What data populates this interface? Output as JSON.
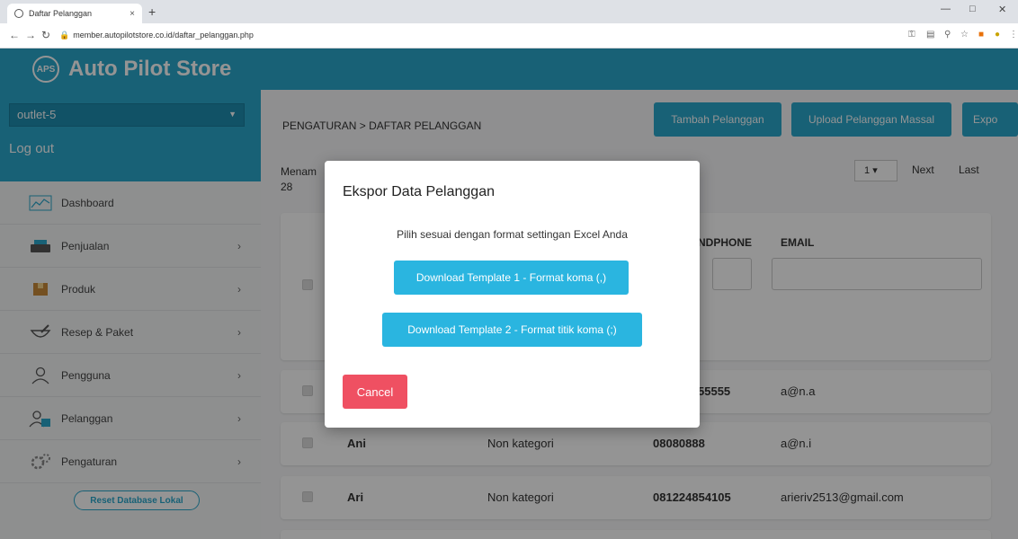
{
  "browser": {
    "tab_title": "Daftar Pelanggan",
    "tab_close": "×",
    "new_tab": "+",
    "url": "member.autopilotstore.co.id/daftar_pelanggan.php"
  },
  "brand": {
    "logo_text": "APS",
    "name": "Auto Pilot Store"
  },
  "user": {
    "outlet": "outlet-5",
    "logout_label": "Log out"
  },
  "menu": [
    {
      "label": "Dashboard",
      "has_submenu": false,
      "icon": "chart-icon"
    },
    {
      "label": "Penjualan",
      "has_submenu": true,
      "icon": "cash-register-icon"
    },
    {
      "label": "Produk",
      "has_submenu": true,
      "icon": "box-icon"
    },
    {
      "label": "Resep & Paket",
      "has_submenu": true,
      "icon": "mortar-icon"
    },
    {
      "label": "Pengguna",
      "has_submenu": true,
      "icon": "user-icon"
    },
    {
      "label": "Pelanggan",
      "has_submenu": true,
      "icon": "customers-icon"
    },
    {
      "label": "Pengaturan",
      "has_submenu": true,
      "icon": "gears-icon"
    }
  ],
  "reset_label": "Reset Database Lokal",
  "page": {
    "breadcrumb": "PENGATURAN > DAFTAR PELANGGAN",
    "buttons": {
      "add": "Tambah Pelanggan",
      "upload": "Upload Pelanggan Massal",
      "export": "Expo"
    },
    "showing_prefix": "Menam",
    "showing_count": "28",
    "pager": {
      "page": "1",
      "next": "Next",
      "last": "Last"
    },
    "columns": {
      "handphone": "NDPHONE",
      "email": "EMAIL"
    }
  },
  "rows": [
    {
      "name": "",
      "category": "",
      "phone": "55555",
      "email": "a@n.a"
    },
    {
      "name": "Ani",
      "category": "Non kategori",
      "phone": "08080888",
      "email": "a@n.i"
    },
    {
      "name": "Ari",
      "category": "Non kategori",
      "phone": "081224854105",
      "email": "arieriv2513@gmail.com"
    }
  ],
  "modal": {
    "title": "Ekspor Data Pelanggan",
    "message": "Pilih sesuai dengan format settingan Excel Anda",
    "download1": "Download Template 1 - Format koma (,)",
    "download2": "Download Template 2 - Format titik koma (;)",
    "cancel": "Cancel"
  },
  "colors": {
    "primary": "#2aa7cc",
    "download": "#2ab5e0",
    "cancel": "#ef5062"
  }
}
